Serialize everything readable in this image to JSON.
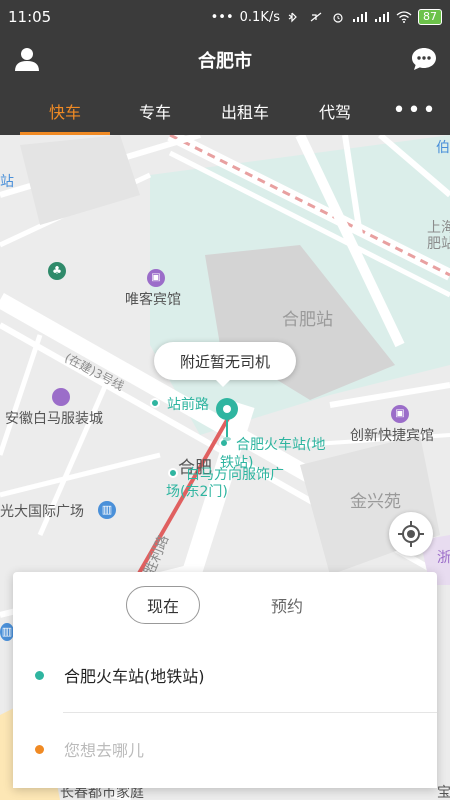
{
  "status_bar": {
    "time": "11:05",
    "dots": "•••",
    "speed": "0.1K/s",
    "battery": "87"
  },
  "header": {
    "title": "合肥市",
    "user_icon": "user-icon",
    "chat_icon": "chat-bubble-icon"
  },
  "tabs": [
    {
      "label": "快车",
      "active": true
    },
    {
      "label": "专车",
      "active": false
    },
    {
      "label": "出租车",
      "active": false
    },
    {
      "label": "代驾",
      "active": false
    }
  ],
  "more_label": "•••",
  "map": {
    "bubble": "附近暂无司机",
    "labels": {
      "weike_hotel": "唯客宾馆",
      "hefei_station": "合肥站",
      "zhanqian_road": "站前路",
      "baima": "安徽白马服装城",
      "hefei_train_station_line1": "合肥火车站(地",
      "hefei_train_station_line2": "铁站)",
      "baima_outlet_line1": "白马方向服饰广",
      "baima_outlet_line2": "场(东2门)",
      "chuangxin_hotel": "创新快捷宾馆",
      "jinxingyuan": "金兴苑",
      "guangda_plaza": "光大国际广场",
      "hefei_big": "合肥",
      "street": "胜利路",
      "shanghai_label1": "上海",
      "shanghai_label2": "肥站",
      "jianyu_road": "(在建)3号线",
      "cut_left": "站",
      "cut_right": "伯",
      "cut_bottom": "长春都市家庭",
      "cut_right2": "浙",
      "cut_left2": "宝"
    }
  },
  "card": {
    "mode_now": "现在",
    "mode_reserve": "预约",
    "origin": "合肥火车站(地铁站)",
    "destination_placeholder": "您想去哪儿"
  },
  "colors": {
    "header_bg": "#3b3b3b",
    "accent": "#f08a24",
    "green": "#2fb5a0",
    "orange_dot": "#f08a24"
  }
}
